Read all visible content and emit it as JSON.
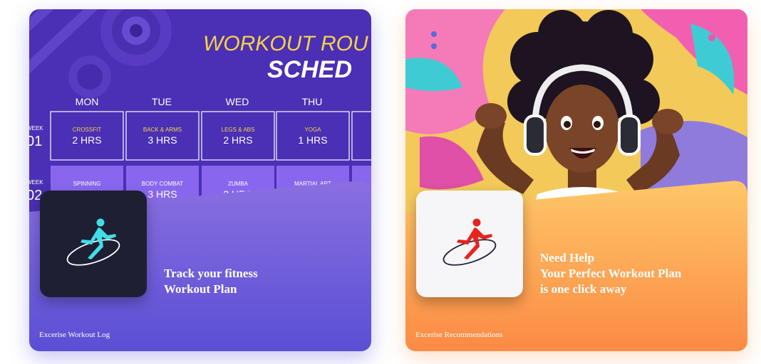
{
  "cards": [
    {
      "schedule": {
        "title_line1": "WORKOUT ROU",
        "title_line2": "SCHED",
        "days": [
          "MON",
          "TUE",
          "WED",
          "THU"
        ],
        "week_label": "WEEK",
        "week1": "01",
        "week2": "02",
        "row1": [
          {
            "activity": "CROSSFIT",
            "hours": "2 HRS"
          },
          {
            "activity": "BACK & ARMS",
            "hours": "3 HRS"
          },
          {
            "activity": "LEGS & ABS",
            "hours": "2 HRS"
          },
          {
            "activity": "YOGA",
            "hours": "1 HRS"
          }
        ],
        "row2": [
          {
            "activity": "SPINNING",
            "hours": ""
          },
          {
            "activity": "BODY COMBAT",
            "hours": "3 HRS"
          },
          {
            "activity": "ZUMBA",
            "hours": "2 HRS"
          },
          {
            "activity": "MARTIAL ART",
            "hours": ""
          }
        ]
      },
      "logo_icon": "runner-logo-icon",
      "tagline": [
        "Track your fitness",
        "Workout Plan"
      ],
      "footer_label": "Excerise Workout Log",
      "colors": {
        "panel_top": "#8a6fe0",
        "panel_bottom": "#5a4fd4",
        "logo_runner": "#3ee0e6"
      }
    },
    {
      "logo_icon": "runner-logo-icon",
      "tagline": [
        "Need Help",
        "Your Perfect Workout Plan",
        "is one click away"
      ],
      "footer_label": "Excerise Recommendations",
      "colors": {
        "panel_top": "#ffc768",
        "panel_bottom": "#fb8a45",
        "logo_runner": "#e8221e"
      }
    }
  ]
}
